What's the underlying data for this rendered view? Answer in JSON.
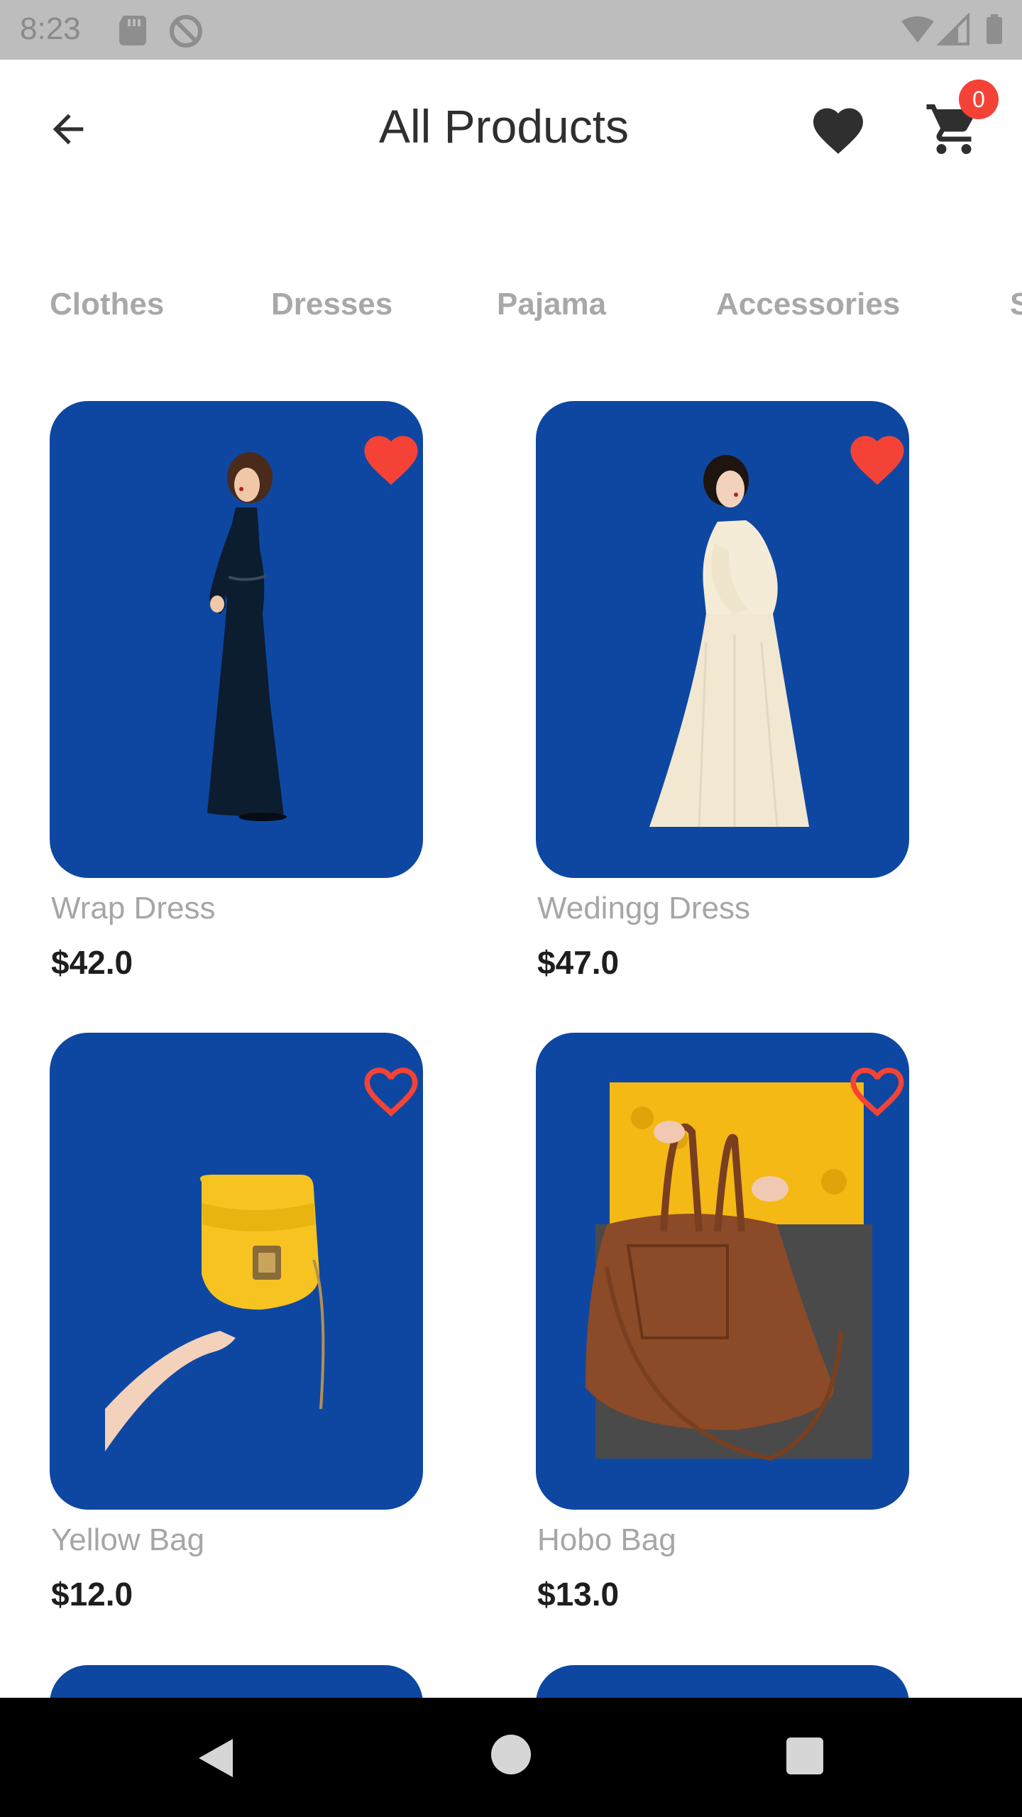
{
  "status_bar": {
    "time": "8:23"
  },
  "app_bar": {
    "title": "All Products",
    "cart_count": "0"
  },
  "categories": [
    "Clothes",
    "Dresses",
    "Pajama",
    "Accessories",
    "S"
  ],
  "products": [
    {
      "name": "Wrap Dress",
      "price": "$42.0",
      "favorite": true
    },
    {
      "name": "Wedingg Dress",
      "price": "$47.0",
      "favorite": true
    },
    {
      "name": "Yellow Bag",
      "price": "$12.0",
      "favorite": false
    },
    {
      "name": "Hobo Bag",
      "price": "$13.0",
      "favorite": false
    }
  ],
  "colors": {
    "card_background": "#0e47a1",
    "favorite": "#f44336",
    "category_text": "#a8a8a8",
    "price_text": "#1e1e1e"
  },
  "icons": [
    "back-arrow-icon",
    "heart-icon",
    "cart-icon",
    "heart-filled-icon",
    "heart-outline-icon"
  ]
}
